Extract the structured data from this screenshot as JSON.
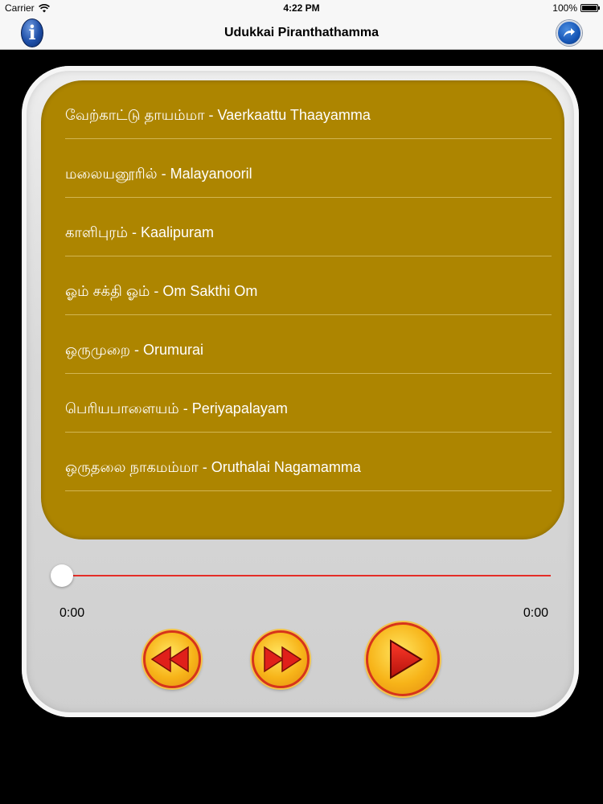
{
  "status_bar": {
    "carrier": "Carrier",
    "time": "4:22 PM",
    "battery": "100%",
    "battery_level": 1.0
  },
  "nav": {
    "title": "Udukkai Piranthathamma",
    "info_label": "i",
    "info_icon": "info-icon",
    "share_icon": "share-arrow-icon"
  },
  "songs": [
    {
      "label": "வேற்காட்டு தாயம்மா - Vaerkaattu Thaayamma"
    },
    {
      "label": "மலையனூரில் - Malayanooril"
    },
    {
      "label": "காளிபுரம் - Kaalipuram"
    },
    {
      "label": "ஓம் சக்தி   ஓம் - Om Sakthi Om"
    },
    {
      "label": "ஒருமுறை - Orumurai"
    },
    {
      "label": "பெரியபாளையம் - Periyapalayam"
    },
    {
      "label": "ஒருதலை நாகமம்மா - Oruthalai Nagamamma"
    }
  ],
  "player": {
    "elapsed": "0:00",
    "total": "0:00",
    "progress": 0.0,
    "colors": {
      "list_bg": "#ad8500",
      "track": "#e52d27",
      "button_fill": "#f7b419",
      "button_ring": "#d7341a"
    },
    "controls": {
      "rewind_icon": "rewind-icon",
      "forward_icon": "fast-forward-icon",
      "play_icon": "play-icon"
    }
  }
}
